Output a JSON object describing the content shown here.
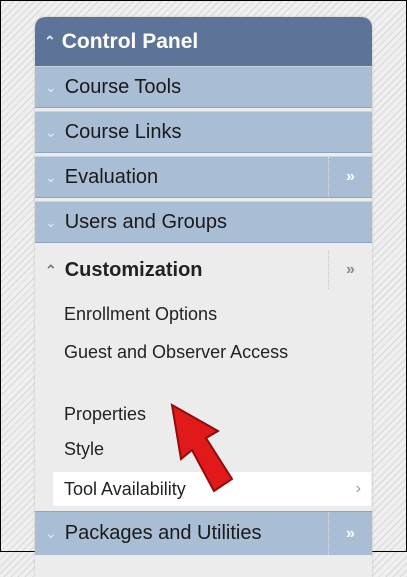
{
  "control_panel": {
    "title": "Control Panel",
    "items": [
      {
        "label": "Course Tools"
      },
      {
        "label": "Course Links"
      },
      {
        "label": "Evaluation"
      },
      {
        "label": "Users and Groups"
      }
    ],
    "customization": {
      "title": "Customization",
      "subitems": [
        {
          "label": "Enrollment Options"
        },
        {
          "label": "Guest and Observer Access"
        },
        {
          "label": "Properties"
        },
        {
          "label": "Style"
        },
        {
          "label": "Tool Availability"
        }
      ]
    },
    "packages": {
      "label": "Packages and Utilities"
    }
  },
  "icons": {
    "collapse": "chevron-up-double-icon",
    "expand": "chevron-down-double-icon",
    "more": "double-right-arrow-icon",
    "pointer": "red-arrow-pointer-icon"
  },
  "colors": {
    "header_bg": "#5d7498",
    "item_bg": "#a9bdd5",
    "panel_bg": "#ececec",
    "pointer": "#e2191b"
  }
}
